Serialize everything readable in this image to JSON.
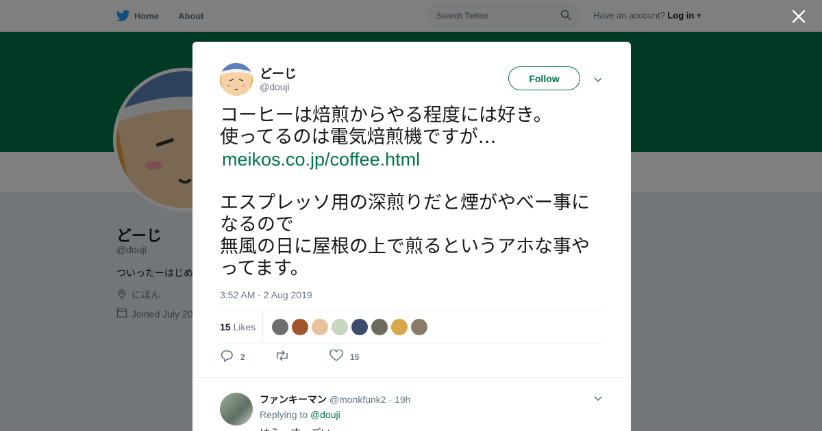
{
  "colors": {
    "accent": "#00744a",
    "banner": "#00744a",
    "text": "#14171a",
    "muted": "#657786"
  },
  "nav": {
    "home_label": "Home",
    "about_label": "About",
    "search_placeholder": "Search Twitter",
    "account_prompt": "Have an account?",
    "login_label": "Log in"
  },
  "profile": {
    "name": "どーじ",
    "handle": "@douji",
    "bio": "ついったーはじめ",
    "location": "にほん",
    "joined": "Joined July 20"
  },
  "tweet": {
    "author_name": "どーじ",
    "author_handle": "@douji",
    "follow_label": "Follow",
    "line1": "コーヒーは焙煎からやる程度には好き。",
    "line2": "使ってるのは電気焙煎機ですが…",
    "link": "meikos.co.jp/coffee.html",
    "line3": "エスプレッソ用の深煎りだと煙がやべー事になるので",
    "line4": "無風の日に屋根の上で煎るというアホな事やってます。",
    "timestamp": "3:52 AM - 2 Aug 2019",
    "likes_count": "15",
    "likes_label": "Likes",
    "reply_count": "2",
    "retweet_count": "",
    "like_count": "15"
  },
  "likers": [
    "#6f6f6f",
    "#a3542d",
    "#e9c29c",
    "#c8d6c0",
    "#3c4a6b",
    "#6d6a5e",
    "#d9a74a",
    "#8a7a6a"
  ],
  "reply": {
    "name": "ファンキーマン",
    "handle": "@monkfunk2",
    "time": "· 19h",
    "replying_prefix": "Replying to",
    "replying_handle": "@douji",
    "text": "はえーすっごい"
  }
}
